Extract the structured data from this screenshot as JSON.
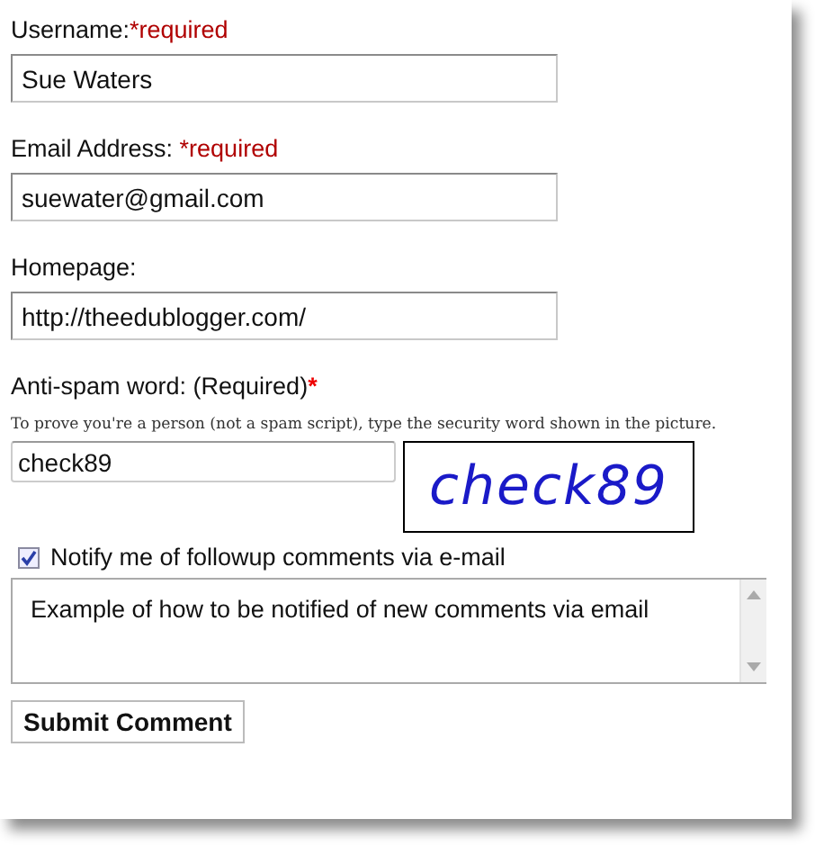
{
  "fields": [
    {
      "label": "Username:",
      "required_note": "*required",
      "value": "Sue Waters"
    },
    {
      "label": "Email Address: ",
      "required_note": "*required",
      "value": "suewater@gmail.com"
    },
    {
      "label": "Homepage:",
      "value": "http://theedublogger.com/"
    }
  ],
  "antispam": {
    "label": "Anti-spam word: (Required)",
    "required_mark": "*",
    "hint": "To prove you're a person (not a spam script), type the security word shown in the picture.",
    "value": "check89",
    "captcha_word": "check89"
  },
  "notify": {
    "label": "Notify me of followup comments via e-mail",
    "checked": true
  },
  "comment": {
    "value": "Example of how to be notified of new comments via email"
  },
  "submit_button": "Submit Comment"
}
